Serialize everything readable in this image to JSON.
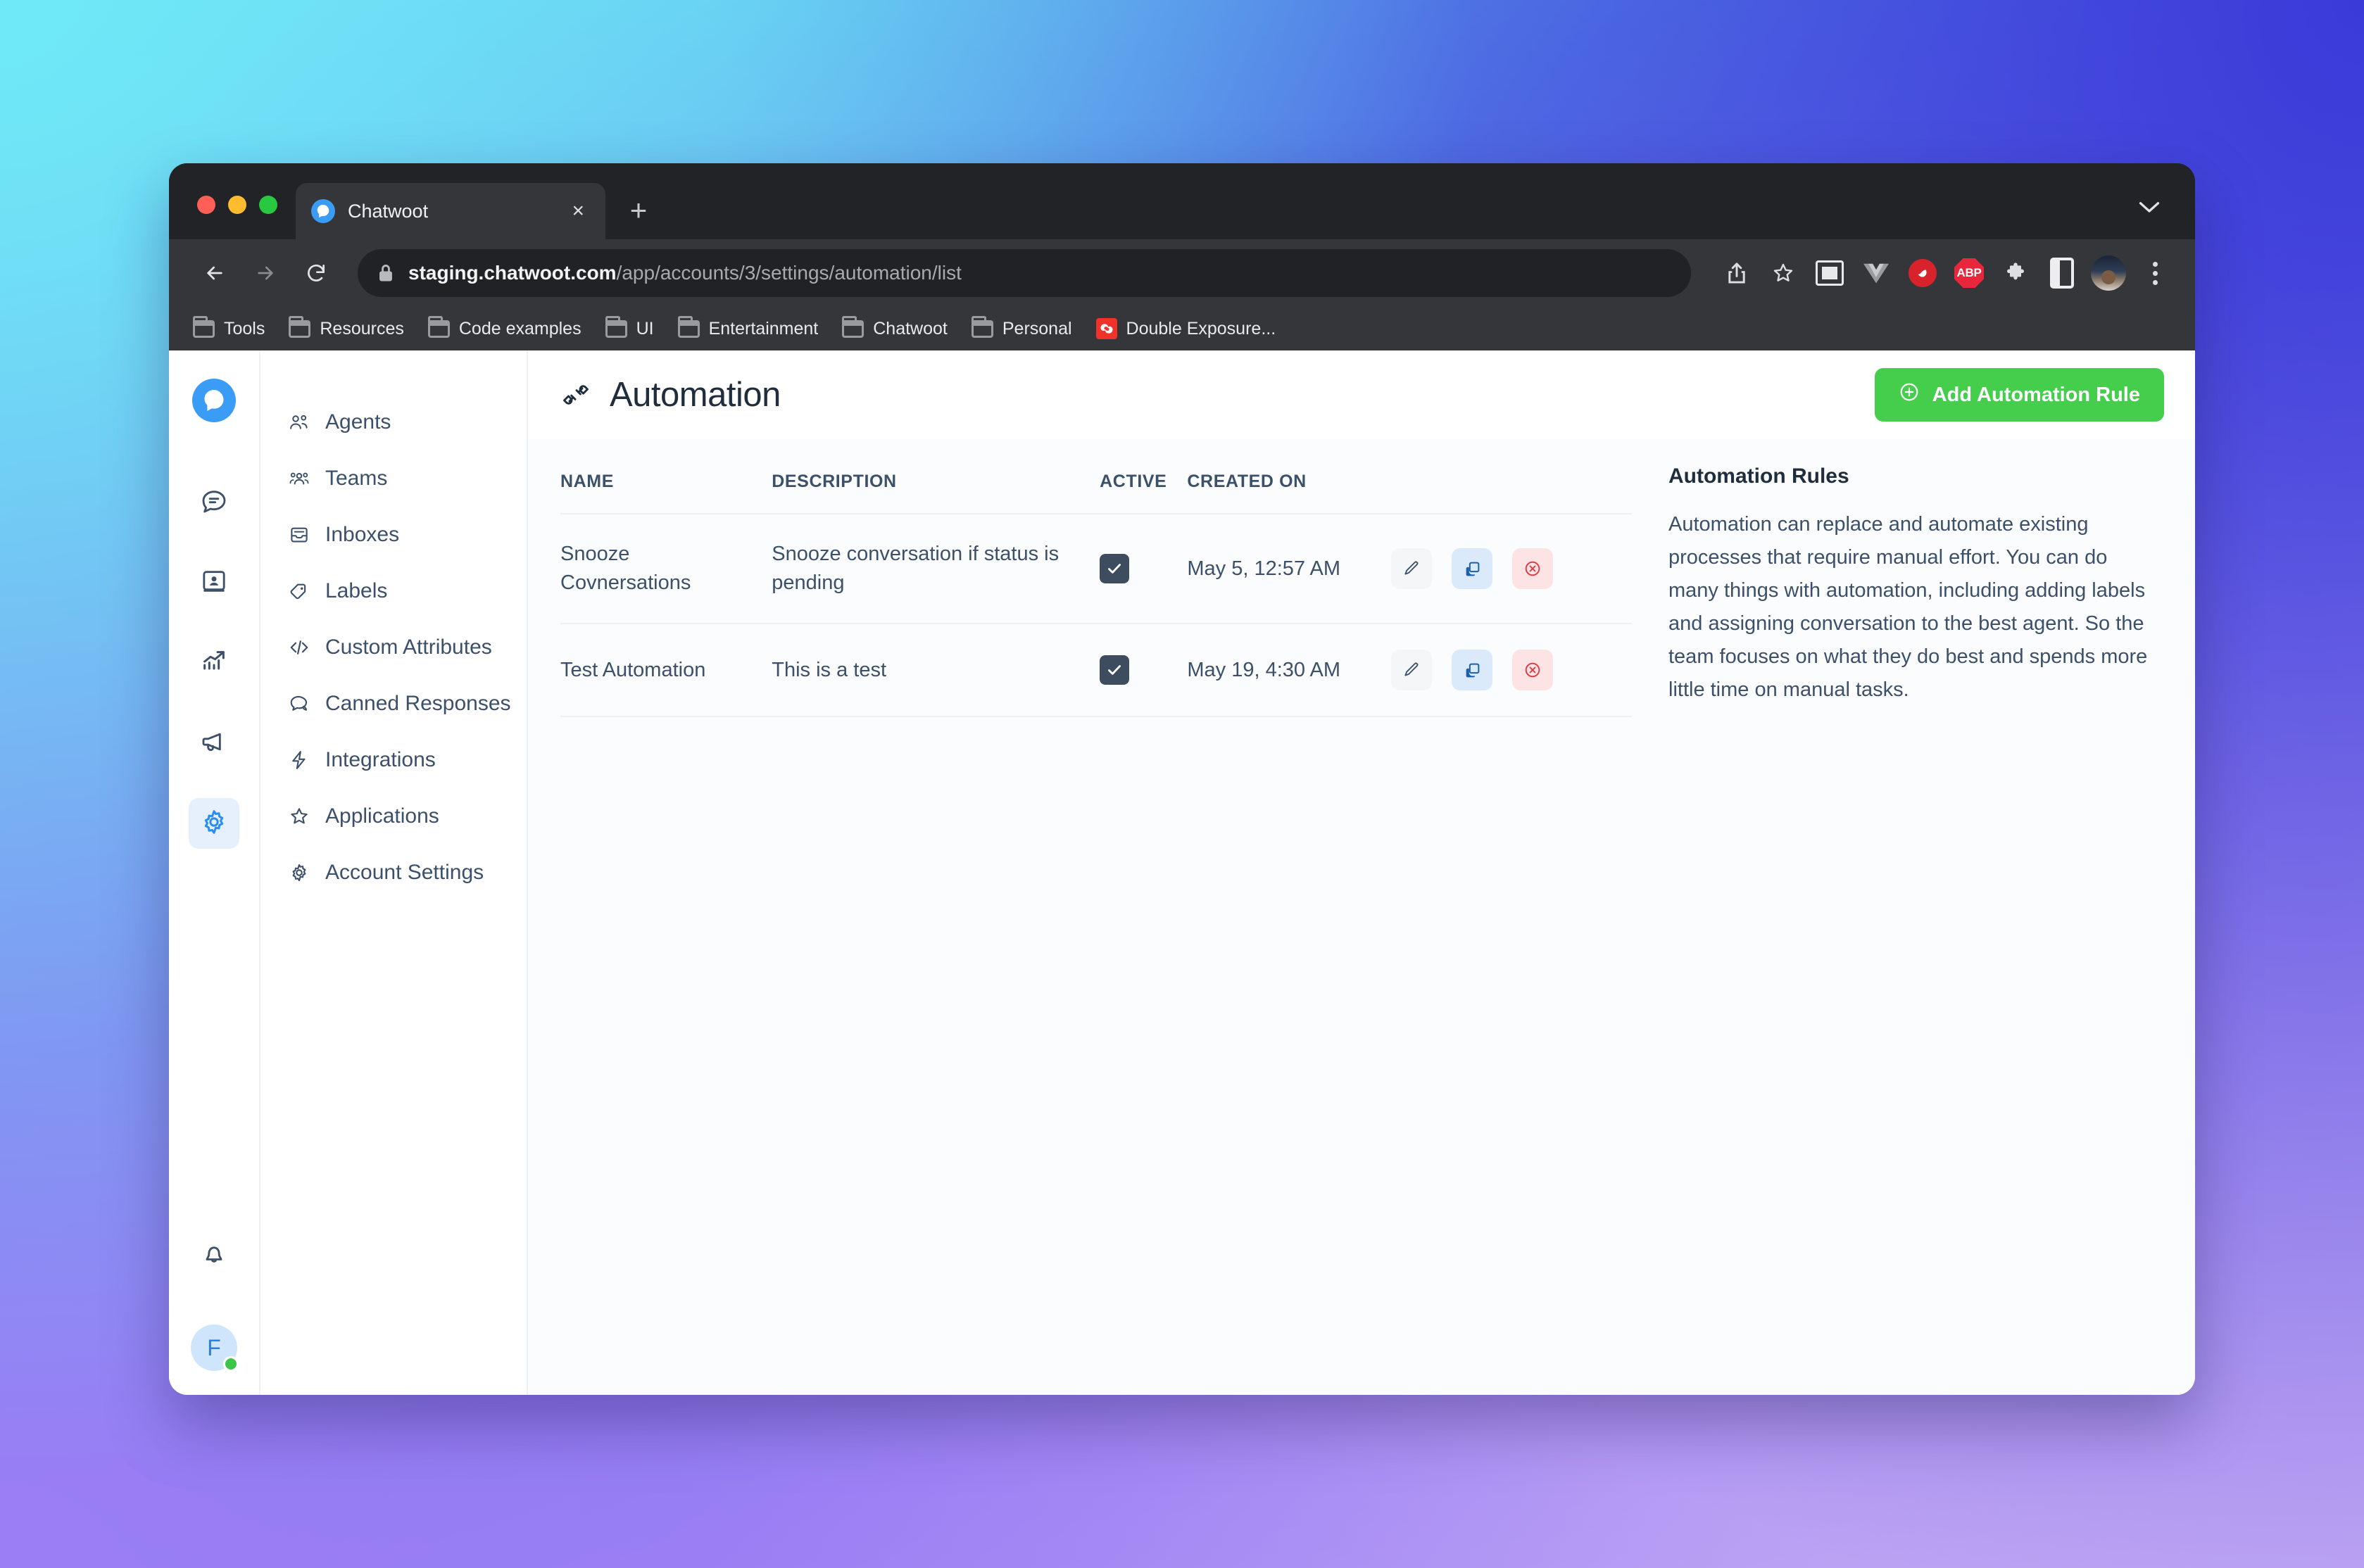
{
  "browser": {
    "tab": {
      "title": "Chatwoot",
      "favicon": "chatwoot-logo-icon",
      "close_label": "×"
    },
    "new_tab_label": "+",
    "tabstrip_chevron": "⌄",
    "nav": {
      "back": "back-icon",
      "forward": "forward-icon",
      "reload": "reload-icon"
    },
    "url": {
      "host": "staging.chatwoot.com",
      "path": "/app/accounts/3/settings/automation/list",
      "secure_icon": "lock-icon"
    },
    "toolbar_icons": [
      "share-icon",
      "bookmark-star-icon",
      "picture-in-picture-icon",
      "vue-devtools-icon",
      "pocket-icon",
      "adblock-plus-icon",
      "extensions-puzzle-icon",
      "sidebar-panel-icon",
      "profile-avatar",
      "chrome-menu-icon"
    ],
    "adblock_label": "ABP",
    "bookmarks": [
      {
        "label": "Tools",
        "icon": "folder-icon"
      },
      {
        "label": "Resources",
        "icon": "folder-icon"
      },
      {
        "label": "Code examples",
        "icon": "folder-icon"
      },
      {
        "label": "UI",
        "icon": "folder-icon"
      },
      {
        "label": "Entertainment",
        "icon": "folder-icon"
      },
      {
        "label": "Chatwoot",
        "icon": "folder-icon"
      },
      {
        "label": "Personal",
        "icon": "folder-icon"
      },
      {
        "label": "Double Exposure...",
        "icon": "site-favicon"
      }
    ]
  },
  "rail": {
    "logo": "chatwoot-logo-icon",
    "items": [
      {
        "name": "conversations",
        "icon": "chat-bubble-icon",
        "active": false
      },
      {
        "name": "contacts",
        "icon": "contacts-book-icon",
        "active": false
      },
      {
        "name": "reports",
        "icon": "reports-chart-icon",
        "active": false
      },
      {
        "name": "campaigns",
        "icon": "megaphone-icon",
        "active": false
      },
      {
        "name": "settings",
        "icon": "gear-icon",
        "active": true
      }
    ],
    "notifications_icon": "bell-icon",
    "avatar_initial": "F",
    "availability": "online"
  },
  "settings_nav": {
    "items": [
      {
        "label": "Agents",
        "icon": "agents-icon"
      },
      {
        "label": "Teams",
        "icon": "teams-icon"
      },
      {
        "label": "Inboxes",
        "icon": "inbox-icon"
      },
      {
        "label": "Labels",
        "icon": "label-tag-icon"
      },
      {
        "label": "Custom Attributes",
        "icon": "code-brackets-icon"
      },
      {
        "label": "Canned Responses",
        "icon": "chat-quote-icon"
      },
      {
        "label": "Integrations",
        "icon": "lightning-plug-icon"
      },
      {
        "label": "Applications",
        "icon": "star-apps-icon"
      },
      {
        "label": "Account Settings",
        "icon": "gear-icon"
      }
    ]
  },
  "page": {
    "icon": "automation-plug-icon",
    "title": "Automation",
    "add_button": {
      "label": "Add Automation Rule",
      "icon": "plus-circle-icon",
      "color": "#44ce4b"
    }
  },
  "table": {
    "columns": [
      "NAME",
      "DESCRIPTION",
      "ACTIVE",
      "CREATED ON",
      ""
    ],
    "rows": [
      {
        "name": "Snooze Covnersations",
        "description": "Snooze conversation if status is pending",
        "active": true,
        "created_on": "May 5, 12:57 AM",
        "actions": [
          "edit-icon",
          "clone-icon",
          "delete-icon"
        ]
      },
      {
        "name": "Test Automation",
        "description": "This is a test",
        "active": true,
        "created_on": "May 19, 4:30 AM",
        "actions": [
          "edit-icon",
          "clone-icon",
          "delete-icon"
        ]
      }
    ]
  },
  "side_panel": {
    "title": "Automation Rules",
    "body": "Automation can replace and automate existing processes that require manual effort. You can do many things with automation, including adding labels and assigning conversation to the best agent. So the team focuses on what they do best and spends more little time on manual tasks."
  }
}
